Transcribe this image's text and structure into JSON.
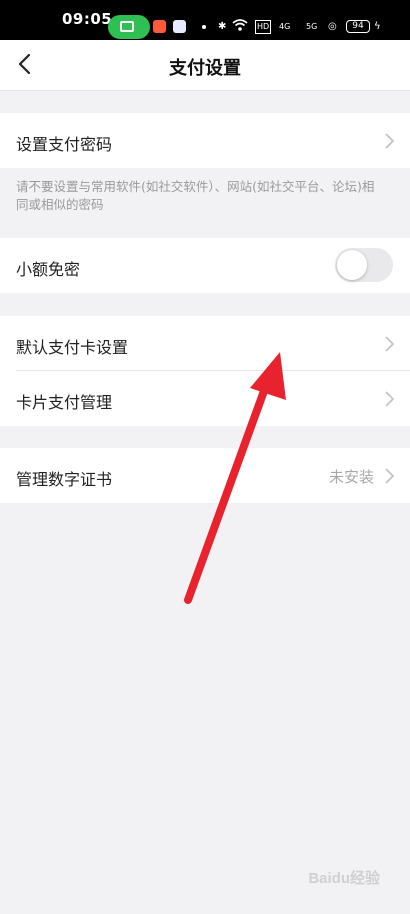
{
  "status_bar": {
    "time": "09:05",
    "battery": "94",
    "hd": "HD",
    "signal1": "4G",
    "signal2": "5G"
  },
  "header": {
    "title": "支付设置"
  },
  "rows": {
    "set_password": {
      "label": "设置支付密码"
    },
    "hint": "请不要设置与常用软件(如社交软件）、网站(如社交平台、论坛)相同或相似的密码",
    "small_free": {
      "label": "小额免密",
      "enabled": false
    },
    "default_card": {
      "label": "默认支付卡设置"
    },
    "card_manage": {
      "label": "卡片支付管理"
    },
    "cert": {
      "label": "管理数字证书",
      "value": "未安装"
    }
  },
  "icons": [
    "back-icon",
    "chevron-right-icon"
  ],
  "colors": {
    "arrow": "#e8232e",
    "toggle_off": "#e9e9eb",
    "hint": "#9a9a9e"
  },
  "watermark": "Baidu经验"
}
